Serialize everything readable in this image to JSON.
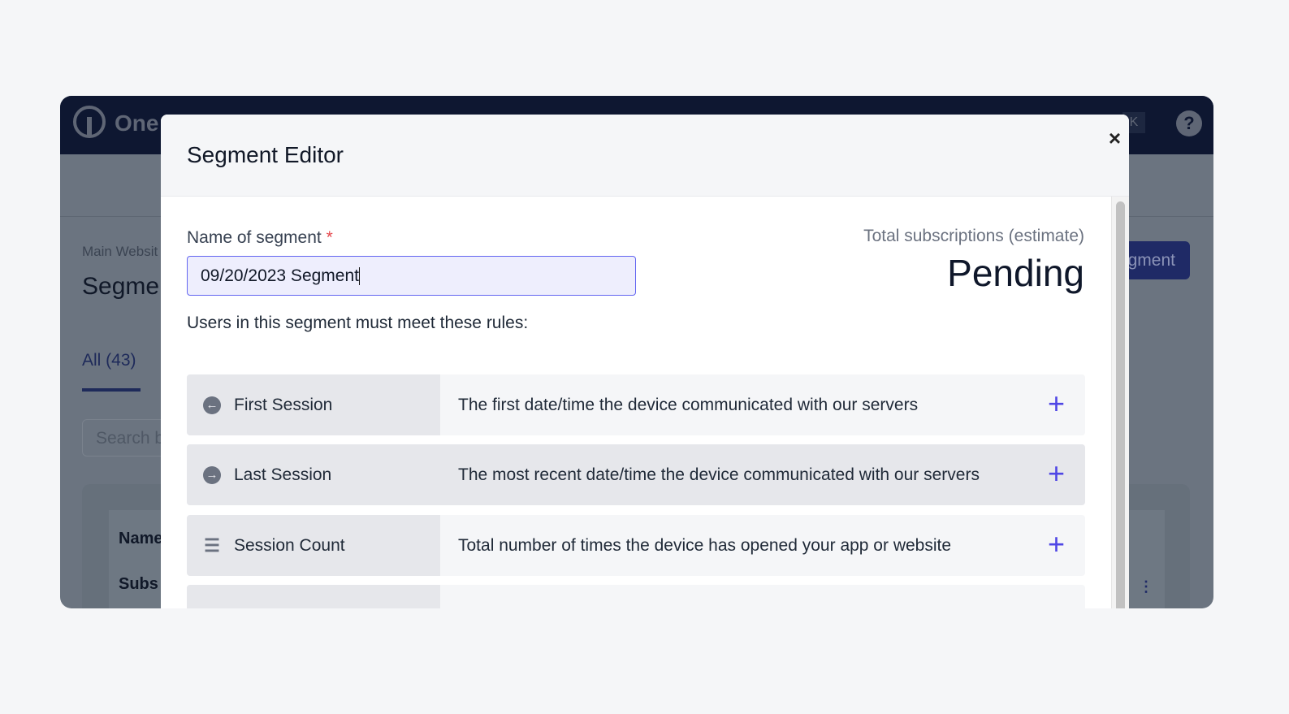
{
  "background": {
    "brand": "One",
    "help": "?",
    "kbd": "K",
    "breadcrumb": "Main Websit",
    "title": "Segmen",
    "tab": "All (43)",
    "search_placeholder": "Search b",
    "new_button": "gment",
    "table_header": "Name",
    "table_row": "Subs"
  },
  "modal": {
    "title": "Segment Editor",
    "close": "×",
    "name_label": "Name of segment",
    "required": "*",
    "name_value": "09/20/2023 Segment",
    "estimate_label": "Total subscriptions (estimate)",
    "estimate_value": "Pending",
    "rules_text": "Users in this segment must meet these rules:",
    "accent": "#4f46e5",
    "filters": [
      {
        "icon": "arrow-left-circle-icon",
        "glyph": "←",
        "label": "First Session",
        "desc": "The first date/time the device communicated with our servers"
      },
      {
        "icon": "arrow-right-circle-icon",
        "glyph": "→",
        "label": "Last Session",
        "desc": "The most recent date/time the device communicated with our servers"
      },
      {
        "icon": "list-icon",
        "glyph": "☰",
        "label": "Session Count",
        "desc": "Total number of times the device has opened your app or website"
      }
    ],
    "add": "+"
  }
}
